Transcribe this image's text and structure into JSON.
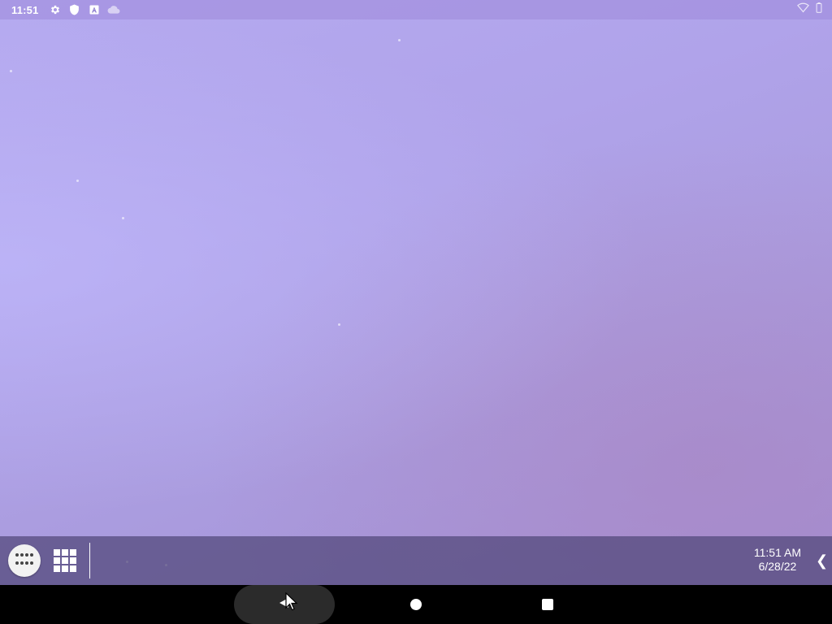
{
  "status_bar": {
    "time": "11:51",
    "left_icons": [
      "gear-icon",
      "shield-icon",
      "a-notification-icon",
      "cloud-icon"
    ],
    "right_icons": [
      "wifi-icon",
      "battery-icon"
    ]
  },
  "taskbar": {
    "clock_time": "11:51 AM",
    "clock_date": "6/28/22",
    "app_drawer_icon": "dots-grid-icon",
    "overview_icon": "window-grid-icon",
    "collapse_glyph": "❮"
  },
  "nav_bar": {
    "back_icon": "back-triangle-icon",
    "home_icon": "home-circle-icon",
    "recents_icon": "recents-square-icon"
  },
  "colors": {
    "wallpaper_top": "#b5aaf0",
    "wallpaper_bottom": "#a391d4",
    "taskbar": "#504678",
    "nav_bar": "#000000"
  }
}
